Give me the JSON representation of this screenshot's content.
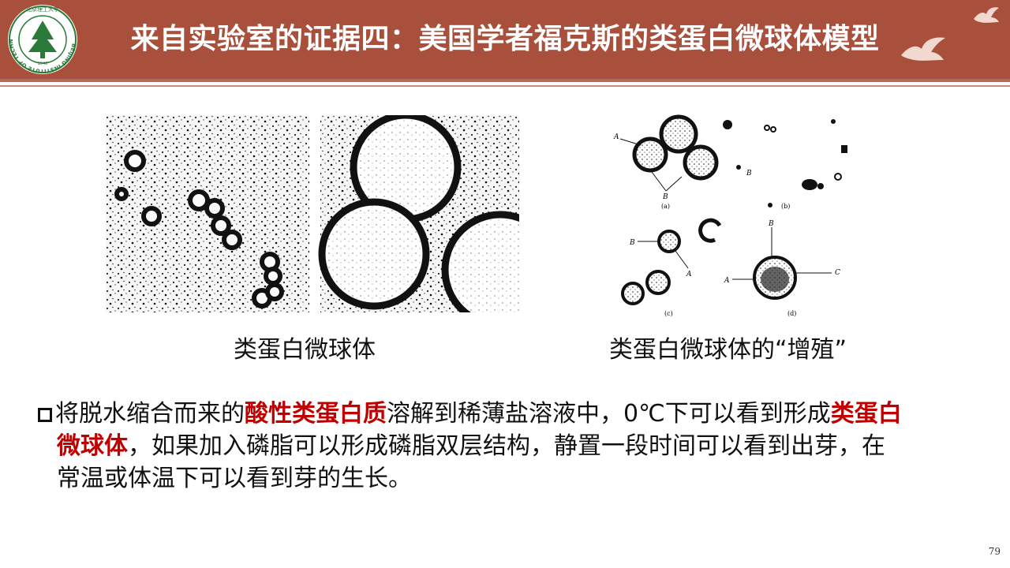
{
  "slide": {
    "title": "来自实验室的证据四：美国学者福克斯的类蛋白微球体模型",
    "page_number": "79"
  },
  "logo": {
    "text": "BEIJING INSTITUTE OF TECHNOLOGY",
    "cn": "北京理工大学",
    "year": "1940"
  },
  "figures": [
    {
      "caption": "类蛋白微球体"
    },
    {
      "caption": "类蛋白微球体的“增殖”",
      "panels": [
        "(a)",
        "(b)",
        "(c)",
        "(d)"
      ],
      "labels": [
        "A",
        "B",
        "B",
        "B",
        "A",
        "B",
        "B",
        "A",
        "C"
      ]
    }
  ],
  "body": {
    "p1": "将脱水缩合而来的",
    "h1": "酸性类蛋白质",
    "p2": "溶解到稀薄盐溶液中，0℃下可以看到形成",
    "h2a": "类蛋白",
    "h2b": "微球体",
    "p3": "，如果加入磷脂可以形成磷脂双层结构，静置一段时间可以看到出芽，在",
    "p4": "常温或体温下可以看到芽的生长。"
  },
  "colors": {
    "header": "#a8503b",
    "highlight": "#c00000"
  }
}
